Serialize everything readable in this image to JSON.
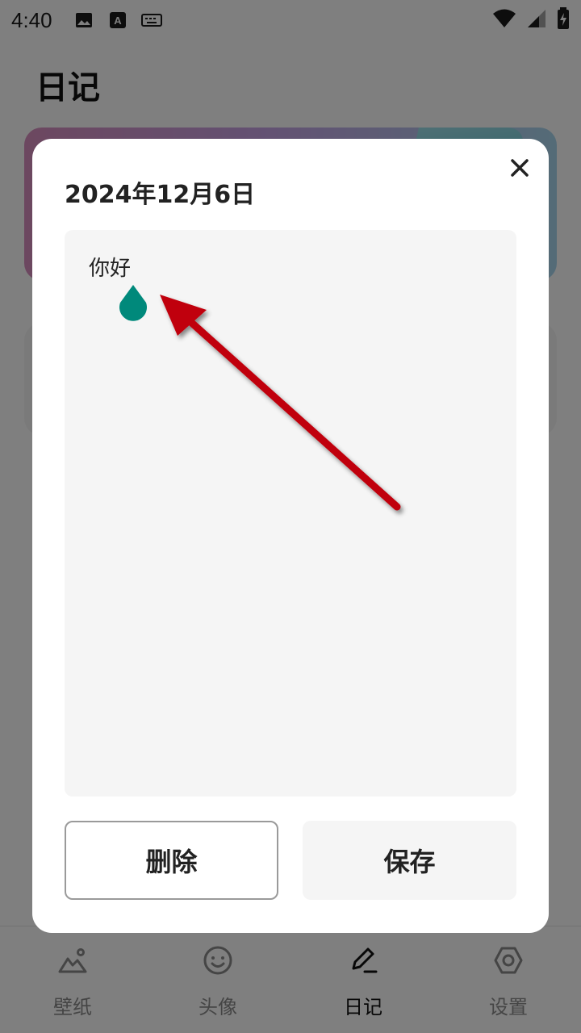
{
  "status_bar": {
    "time": "4:40",
    "icons": [
      "image-icon",
      "font-icon",
      "keyboard-icon"
    ],
    "right_icons": [
      "wifi-icon",
      "signal-icon",
      "battery-charging-icon"
    ]
  },
  "page": {
    "title": "日记"
  },
  "dialog": {
    "date": "2024年12月6日",
    "content": "你好",
    "delete_label": "删除",
    "save_label": "保存",
    "close_icon": "close-icon"
  },
  "bottom_nav": {
    "items": [
      {
        "label": "壁纸",
        "icon": "mountain-icon",
        "active": false
      },
      {
        "label": "头像",
        "icon": "smiley-icon",
        "active": false
      },
      {
        "label": "日记",
        "icon": "pen-icon",
        "active": true
      },
      {
        "label": "设置",
        "icon": "gear-icon",
        "active": false
      }
    ]
  },
  "colors": {
    "overlay": "#000000",
    "cursor_handle": "#00897b",
    "annotation_arrow": "#c0000a",
    "dialog_bg": "#ffffff",
    "input_bg": "#f5f5f5"
  }
}
